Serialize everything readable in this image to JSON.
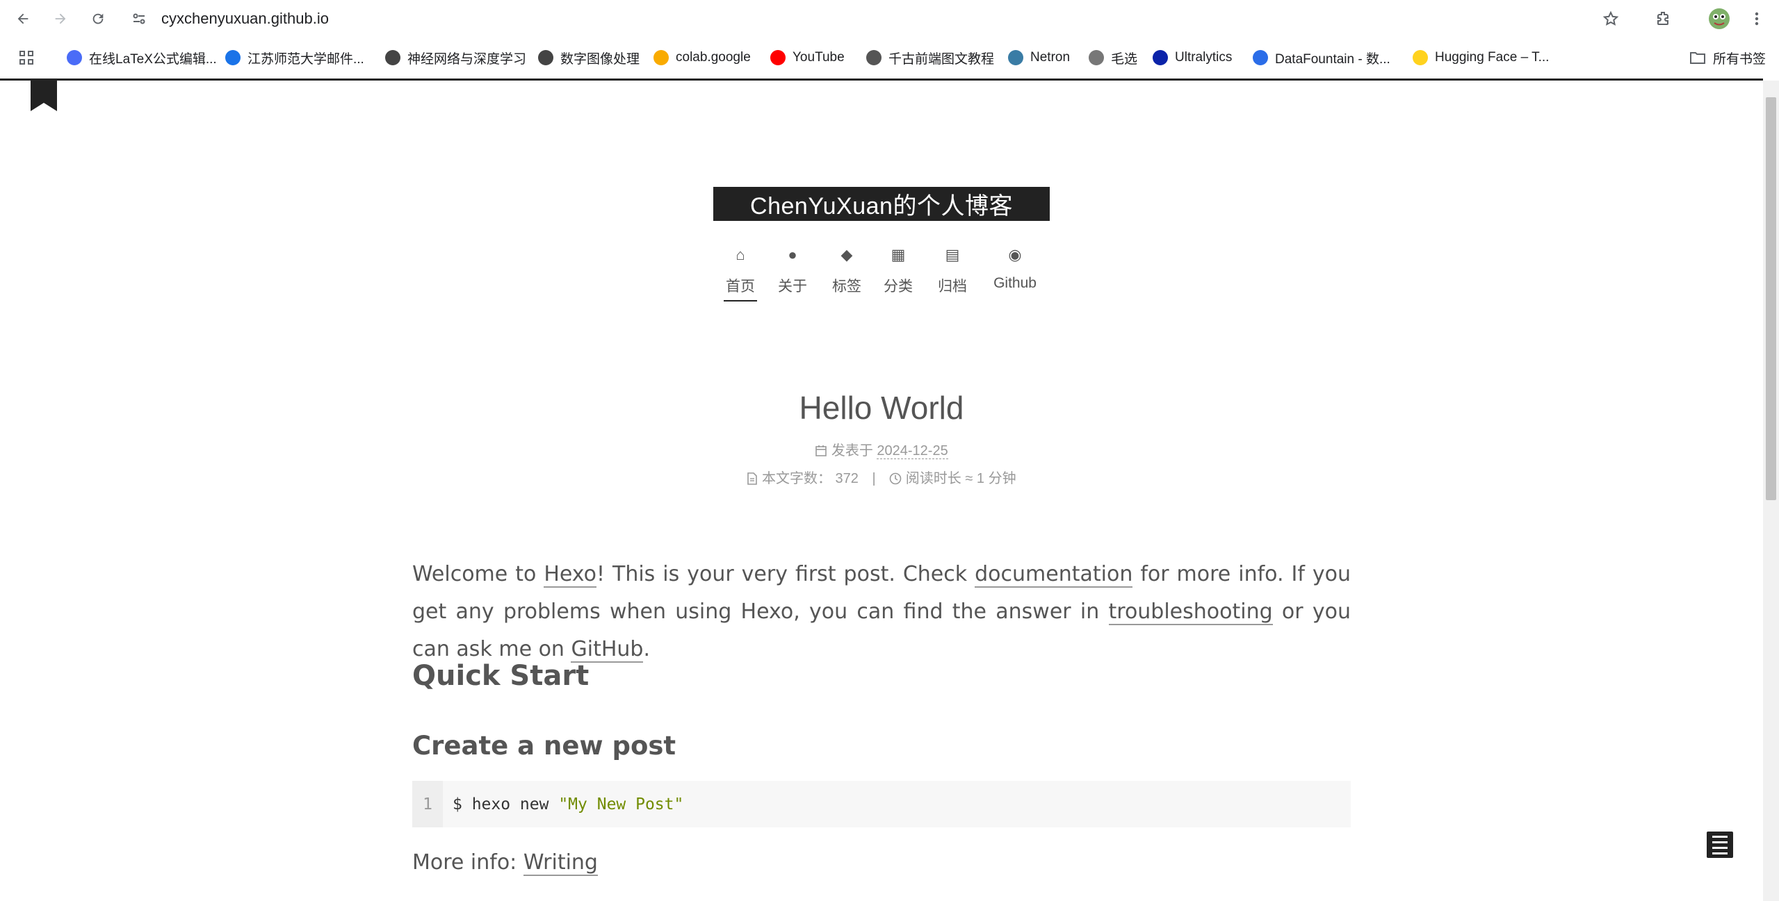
{
  "browser": {
    "url": "cyxchenyuxuan.github.io",
    "bookmarks": [
      {
        "label": "在线LaTeX公式编辑...",
        "icon": "latex-icon",
        "color": "#4a6cf7"
      },
      {
        "label": "江苏师范大学邮件...",
        "icon": "mail-icon",
        "color": "#1a73e8"
      },
      {
        "label": "神经网络与深度学习",
        "icon": "site-icon",
        "color": "#444"
      },
      {
        "label": "数字图像处理",
        "icon": "site-icon",
        "color": "#444"
      },
      {
        "label": "colab.google",
        "icon": "colab-icon",
        "color": "#f9ab00"
      },
      {
        "label": "YouTube",
        "icon": "youtube-icon",
        "color": "#ff0000"
      },
      {
        "label": "千古前端图文教程",
        "icon": "globe-icon",
        "color": "#555"
      },
      {
        "label": "Netron",
        "icon": "netron-icon",
        "color": "#3a7ca5"
      },
      {
        "label": "毛选",
        "icon": "image-icon",
        "color": "#777"
      },
      {
        "label": "Ultralytics",
        "icon": "ultralytics-icon",
        "color": "#0b23a9"
      },
      {
        "label": "DataFountain - 数...",
        "icon": "datafountain-icon",
        "color": "#2b6de8"
      },
      {
        "label": "Hugging Face – T...",
        "icon": "hugging-face-icon",
        "color": "#ffd21e"
      }
    ],
    "all_bookmarks": "所有书签"
  },
  "site": {
    "brand": "ChenYuXuan的个人博客",
    "menu": [
      {
        "label": "首页",
        "icon": "home-icon",
        "glyph": "⌂",
        "active": true
      },
      {
        "label": "关于",
        "icon": "user-icon",
        "glyph": "●",
        "active": false
      },
      {
        "label": "标签",
        "icon": "tags-icon",
        "glyph": "◆",
        "active": false
      },
      {
        "label": "分类",
        "icon": "th-icon",
        "glyph": "▦",
        "active": false
      },
      {
        "label": "归档",
        "icon": "archive-icon",
        "glyph": "▤",
        "active": false
      },
      {
        "label": "Github",
        "icon": "github-icon",
        "glyph": "◉",
        "active": false
      }
    ]
  },
  "post": {
    "title": "Hello World",
    "posted_label": "发表于",
    "date": "2024-12-25",
    "wordcount_label": "本文字数：",
    "wordcount": "372",
    "separator": "|",
    "readtime_label": "阅读时长 ≈",
    "readtime": "1 分钟",
    "intro": {
      "p1": "Welcome to ",
      "hexo": "Hexo",
      "p2": "! This is your very first post. Check ",
      "documentation": "documentation",
      "p3": " for more info. If you get any problems when using Hexo, you can find the answer in ",
      "troubleshooting": "troubleshooting",
      "p4": " or you can ask me on ",
      "github": "GitHub",
      "p5": "."
    },
    "h_quick_start": "Quick Start",
    "h_create_post": "Create a new post",
    "code": {
      "line_no": "1",
      "cmd": "$ hexo new ",
      "arg": "\"My New Post\""
    },
    "more_info_label": "More info: ",
    "more_info_link": "Writing"
  }
}
